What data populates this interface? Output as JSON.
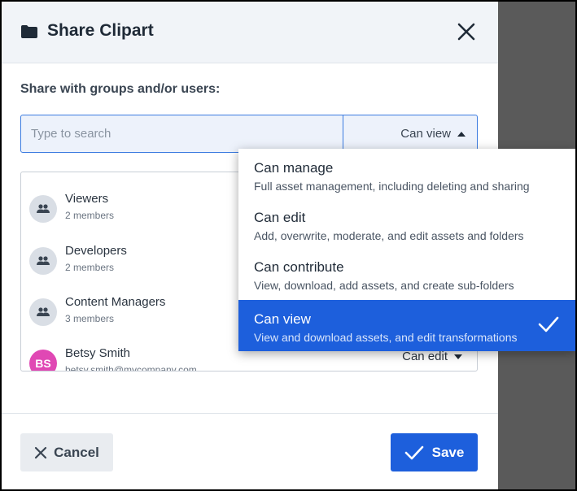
{
  "dialog": {
    "title": "Share Clipart",
    "section_label": "Share with groups and/or users:",
    "search": {
      "placeholder": "Type to search",
      "value": ""
    },
    "permission_select": {
      "selected": "Can view"
    },
    "members": [
      {
        "name": "Viewers",
        "subtitle": "2 members",
        "type": "group"
      },
      {
        "name": "Developers",
        "subtitle": "2 members",
        "type": "group"
      },
      {
        "name": "Content Managers",
        "subtitle": "3 members",
        "type": "group"
      },
      {
        "name": "Betsy Smith",
        "subtitle": "betsy.smith@mycompany.com",
        "type": "user",
        "initials": "BS",
        "permission": "Can edit",
        "avatar_color": "#e048b4"
      }
    ],
    "footer": {
      "cancel_label": "Cancel",
      "save_label": "Save"
    }
  },
  "permission_menu": {
    "options": [
      {
        "title": "Can manage",
        "description": "Full asset management, including deleting and sharing",
        "selected": false
      },
      {
        "title": "Can edit",
        "description": "Add, overwrite, moderate, and edit assets and folders",
        "selected": false
      },
      {
        "title": "Can contribute",
        "description": "View, download, add assets, and create sub-folders",
        "selected": false
      },
      {
        "title": "Can view",
        "description": "View and download assets, and edit transformations",
        "selected": true
      }
    ]
  },
  "colors": {
    "accent": "#1d5fdc",
    "header_bg": "#f1f4f8",
    "backdrop": "#5a5a5a",
    "avatar_user": "#e048b4"
  },
  "icons": [
    "folder-icon",
    "close-icon",
    "caret-up-icon",
    "caret-down-icon",
    "group-icon",
    "checkmark-icon",
    "x-icon"
  ]
}
